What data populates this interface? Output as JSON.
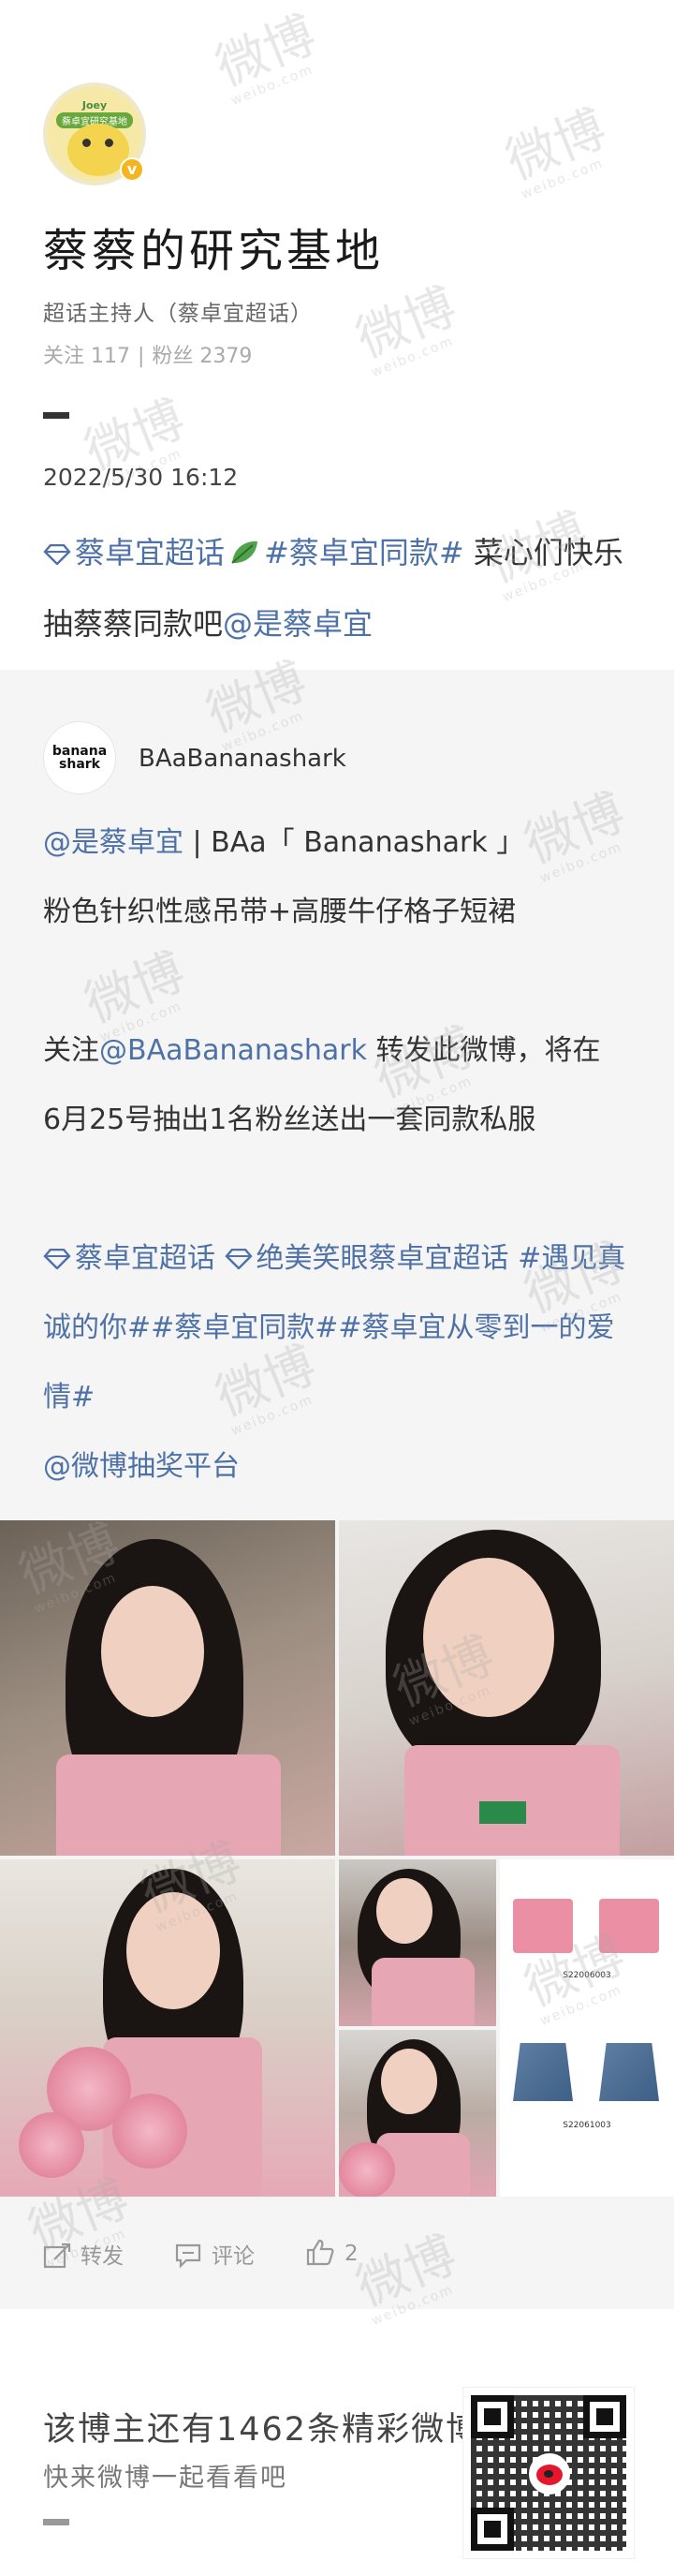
{
  "profile": {
    "avatar_badge_top": "Joey",
    "avatar_badge_mid": "蔡卓宜研究基地",
    "title": "蔡蔡的研究基地",
    "subtitle": "超话主持人（蔡卓宜超话）",
    "follow_label": "关注 117",
    "fans_label": "粉丝 2379",
    "separator": "|"
  },
  "post": {
    "date": "2022/5/30 16:12",
    "topic1": "蔡卓宜超话",
    "topic2": "#蔡卓宜同款#",
    "text_rest": " 菜心们快乐抽蔡蔡同款吧",
    "mention": "@是蔡卓宜"
  },
  "repost": {
    "avatar_line1": "banana",
    "avatar_line2": "shark",
    "username": "BAaBananashark",
    "line1_mention": "@是蔡卓宜",
    "line1_rest": " | BAa「 Bananashark 」",
    "line2": "粉色针织性感吊带+高腰牛仔格子短裙",
    "line3_prefix": "关注",
    "line3_mention": "@BAaBananashark",
    "line3_rest": " 转发此微博，将在",
    "line4": "6月25号抽出1名粉丝送出一套同款私服",
    "tags_line": "蔡卓宜超话  绝美笑眼蔡卓宜超话 #遇见真诚的你##蔡卓宜同款##蔡卓宜从零到一的爱情#",
    "tag_a": "蔡卓宜超话",
    "tag_b": "绝美笑眼蔡卓宜超话",
    "tag_c": "#遇见真诚的你##蔡卓宜同款##蔡卓宜从零到一的爱情#",
    "platform_mention": "@微博抽奖平台",
    "product_code_1": "S22006003",
    "product_code_2": "S22061003"
  },
  "actions": {
    "repost_label": "转发",
    "comment_label": "评论",
    "like_count": "2"
  },
  "footer": {
    "title": "该博主还有1462条精彩微博",
    "subtitle": "快来微博一起看看吧"
  },
  "watermark": {
    "text": "微博",
    "sub": "weibo.com"
  }
}
